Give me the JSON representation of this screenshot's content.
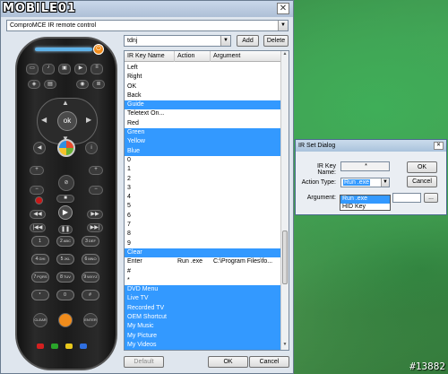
{
  "window": {
    "logo_text": "MOBILE01",
    "title_fragment": "...ial...",
    "close_symbol": "✕"
  },
  "device_select": {
    "value": "ComproMCE IR remote control"
  },
  "remote": {
    "ok": "ok",
    "keys": [
      {
        "label": "1",
        "sub": ""
      },
      {
        "label": "2",
        "sub": "ABC"
      },
      {
        "label": "3",
        "sub": "DEF"
      },
      {
        "label": "4",
        "sub": "GHI"
      },
      {
        "label": "5",
        "sub": "JKL"
      },
      {
        "label": "6",
        "sub": "MNO"
      },
      {
        "label": "7",
        "sub": "PQRS"
      },
      {
        "label": "8",
        "sub": "TUV"
      },
      {
        "label": "9",
        "sub": "WXYZ"
      },
      {
        "label": "*",
        "sub": ""
      },
      {
        "label": "0",
        "sub": ""
      },
      {
        "label": "#",
        "sub": ""
      }
    ],
    "clear": "CLEAR",
    "enter": "ENTER"
  },
  "profile": {
    "value": "tdnj",
    "add": "Add",
    "delete": "Delete"
  },
  "list": {
    "headers": [
      "IR Key Name",
      "Action",
      "Argument"
    ],
    "rows": [
      {
        "name": "Left",
        "action": "",
        "arg": "",
        "sel": false
      },
      {
        "name": "Right",
        "action": "",
        "arg": "",
        "sel": false
      },
      {
        "name": "OK",
        "action": "",
        "arg": "",
        "sel": false
      },
      {
        "name": "Back",
        "action": "",
        "arg": "",
        "sel": false
      },
      {
        "name": "Guide",
        "action": "",
        "arg": "",
        "sel": true
      },
      {
        "name": "Teletext On...",
        "action": "",
        "arg": "",
        "sel": false
      },
      {
        "name": "Red",
        "action": "",
        "arg": "",
        "sel": false
      },
      {
        "name": "Green",
        "action": "",
        "arg": "",
        "sel": true
      },
      {
        "name": "Yellow",
        "action": "",
        "arg": "",
        "sel": true
      },
      {
        "name": "Blue",
        "action": "",
        "arg": "",
        "sel": true
      },
      {
        "name": "0",
        "action": "",
        "arg": "",
        "sel": false
      },
      {
        "name": "1",
        "action": "",
        "arg": "",
        "sel": false
      },
      {
        "name": "2",
        "action": "",
        "arg": "",
        "sel": false
      },
      {
        "name": "3",
        "action": "",
        "arg": "",
        "sel": false
      },
      {
        "name": "4",
        "action": "",
        "arg": "",
        "sel": false
      },
      {
        "name": "5",
        "action": "",
        "arg": "",
        "sel": false
      },
      {
        "name": "6",
        "action": "",
        "arg": "",
        "sel": false
      },
      {
        "name": "7",
        "action": "",
        "arg": "",
        "sel": false
      },
      {
        "name": "8",
        "action": "",
        "arg": "",
        "sel": false
      },
      {
        "name": "9",
        "action": "",
        "arg": "",
        "sel": false
      },
      {
        "name": "Clear",
        "action": "",
        "arg": "",
        "sel": true
      },
      {
        "name": "Enter",
        "action": "Run .exe",
        "arg": "C:\\Program Files\\fo...",
        "sel": false
      },
      {
        "name": "#",
        "action": "",
        "arg": "",
        "sel": false
      },
      {
        "name": "*",
        "action": "",
        "arg": "",
        "sel": false
      },
      {
        "name": "DVD Menu",
        "action": "",
        "arg": "",
        "sel": true
      },
      {
        "name": "Live TV",
        "action": "",
        "arg": "",
        "sel": true
      },
      {
        "name": "Recorded TV",
        "action": "",
        "arg": "",
        "sel": true
      },
      {
        "name": "OEM Shortcut",
        "action": "",
        "arg": "",
        "sel": true
      },
      {
        "name": "My Music",
        "action": "",
        "arg": "",
        "sel": true
      },
      {
        "name": "My Picture",
        "action": "",
        "arg": "",
        "sel": true
      },
      {
        "name": "My Videos",
        "action": "",
        "arg": "",
        "sel": true
      }
    ]
  },
  "footer": {
    "default": "Default",
    "ok": "OK",
    "cancel": "Cancel"
  },
  "dialog": {
    "title": "IR Set Dialog",
    "ir_key_label": "IR Key Name:",
    "ir_key_value": "*",
    "action_label": "Action Type:",
    "action_value": "Run .exe",
    "argument_label": "Argument:",
    "argument_value": "",
    "browse": "...",
    "ok": "OK",
    "cancel": "Cancel",
    "options": [
      "Run .exe",
      "HID Key"
    ]
  },
  "watermark": "#13882"
}
